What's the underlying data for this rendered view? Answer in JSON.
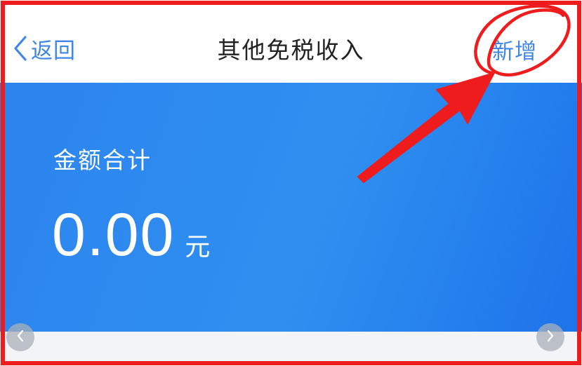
{
  "nav": {
    "back_label": "返回",
    "back_icon": "chevron-left-icon",
    "title": "其他免税收入",
    "add_label": "新增"
  },
  "summary": {
    "label": "金额合计",
    "amount": "0.00",
    "unit": "元"
  },
  "carousel": {
    "prev_icon": "chevron-left-icon",
    "next_icon": "chevron-right-icon"
  },
  "colors": {
    "accent": "#3f86e6",
    "card_blue": "#2c84ee",
    "annotation_red": "#ee1c1c",
    "background": "#f2f4f8"
  }
}
